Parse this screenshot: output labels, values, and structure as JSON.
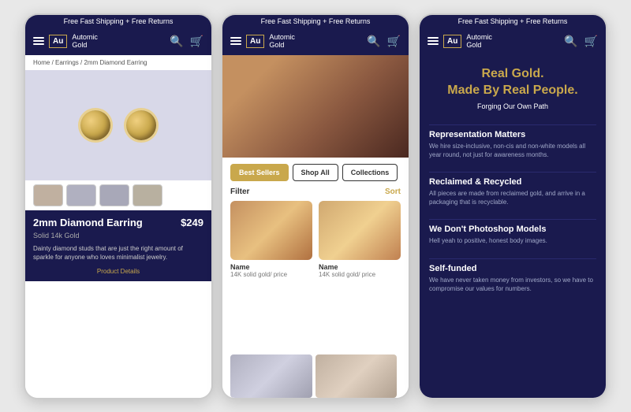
{
  "colors": {
    "navy": "#1a1a4e",
    "gold": "#c9a84c",
    "white": "#ffffff"
  },
  "phone1": {
    "topbar": "Free Fast Shipping + Free Returns",
    "nav": {
      "logo_au": "Au",
      "logo_name_line1": "Automic",
      "logo_name_line2": "Gold"
    },
    "breadcrumb": "Home / Earrings / 2mm Diamond Earring",
    "product": {
      "title": "2mm Diamond Earring",
      "price": "$249",
      "subtitle": "Solid 14k Gold",
      "description": "Dainty diamond studs that are just the right amount of sparkle for anyone who loves minimalist jewelry.",
      "detail_link": "Product Details"
    }
  },
  "phone2": {
    "topbar": "Free Fast Shipping + Free Returns",
    "nav": {
      "logo_au": "Au",
      "logo_name_line1": "Automic",
      "logo_name_line2": "Gold"
    },
    "tabs": [
      {
        "label": "Best Sellers",
        "active": true
      },
      {
        "label": "Shop All",
        "active": false
      },
      {
        "label": "Collections",
        "active": false
      }
    ],
    "filter_label": "Filter",
    "sort_label": "Sort",
    "products": [
      {
        "name": "Name",
        "sub": "14K solid gold/ price"
      },
      {
        "name": "Name",
        "sub": "14K solid gold/ price"
      }
    ]
  },
  "phone3": {
    "topbar": "Free Fast Shipping + Free Returns",
    "nav": {
      "logo_au": "Au",
      "logo_name_line1": "Automic",
      "logo_name_line2": "Gold"
    },
    "hero_title_line1": "Real Gold.",
    "hero_title_line2": "Made By Real People.",
    "hero_subtitle": "Forging Our Own Path",
    "sections": [
      {
        "heading": "Representation Matters",
        "body": "We hire size-inclusive, non-cis and non-white models all year round, not just for awareness months."
      },
      {
        "heading": "Reclaimed & Recycled",
        "body": "All pieces are made from reclaimed gold, and arrive in a packaging that is recyclable."
      },
      {
        "heading": "We Don't Photoshop Models",
        "body": "Hell yeah to positive, honest body images."
      },
      {
        "heading": "Self-funded",
        "body": "We have never taken money from investors, so we have to compromise our values for numbers."
      }
    ]
  }
}
